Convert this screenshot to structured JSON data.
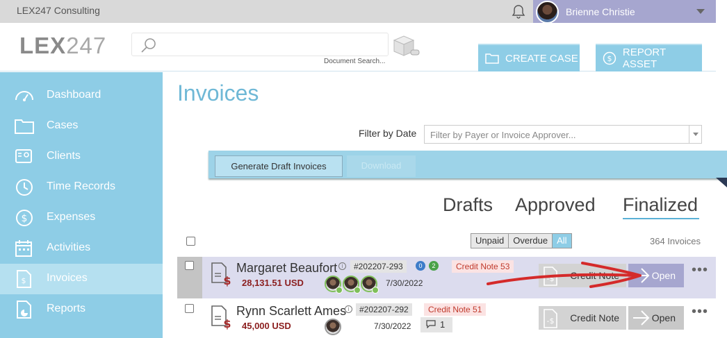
{
  "topbar": {
    "company": "LEX247 Consulting",
    "user_name": "Brienne Christie"
  },
  "header": {
    "logo_bold": "LEX",
    "logo_thin": "247",
    "search_placeholder": "",
    "search_hint": "Document Search...",
    "create_case": "CREATE CASE",
    "report_asset": "REPORT ASSET"
  },
  "sidebar": {
    "items": [
      {
        "label": "Dashboard",
        "icon": "gauge-icon"
      },
      {
        "label": "Cases",
        "icon": "folder-icon"
      },
      {
        "label": "Clients",
        "icon": "contact-card-icon"
      },
      {
        "label": "Time Records",
        "icon": "clock-icon"
      },
      {
        "label": "Expenses",
        "icon": "dollar-circle-icon"
      },
      {
        "label": "Activities",
        "icon": "calendar-icon"
      },
      {
        "label": "Invoices",
        "icon": "invoice-icon",
        "active": true
      },
      {
        "label": "Reports",
        "icon": "report-chart-icon"
      }
    ]
  },
  "main": {
    "title": "Invoices",
    "filter_label": "Filter by Date",
    "filter_placeholder": "Filter by Payer or Invoice Approver...",
    "generate_label": "Generate Draft Invoices",
    "download_label": "Download",
    "tabs": [
      "Drafts",
      "Approved",
      "Finalized"
    ],
    "active_tab": "Finalized",
    "segments": [
      "Unpaid",
      "Overdue",
      "All"
    ],
    "active_segment": "All",
    "count": "364 Invoices"
  },
  "invoices": [
    {
      "name": "Margaret Beaufort",
      "amount": "28,131.51 USD",
      "number": "#202207-293",
      "badge_blue": "0",
      "badge_green": "2",
      "credit_note": "Credit Note 53",
      "date": "7/30/2022",
      "credit_btn": "Credit Note",
      "open_btn": "Open"
    },
    {
      "name": "Rynn Scarlett Ames",
      "amount": "45,000 USD",
      "number": "#202207-292",
      "credit_note": "Credit Note 51",
      "date": "7/30/2022",
      "comments": "1",
      "credit_btn": "Credit Note",
      "open_btn": "Open"
    }
  ],
  "colors": {
    "accent": "#8ecde6",
    "title": "#6fb8d6",
    "amount": "#8b1e1e",
    "user_bar": "#a6a6cf",
    "annotation_arrow": "#d42a2a"
  }
}
